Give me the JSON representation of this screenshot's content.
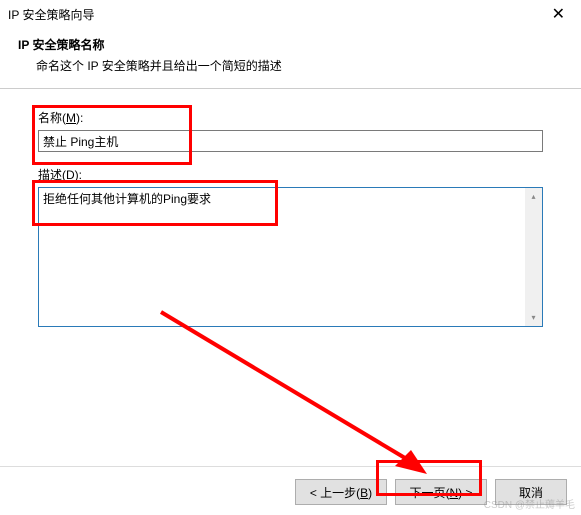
{
  "window": {
    "title": "IP 安全策略向导",
    "close_glyph": "✕"
  },
  "header": {
    "title": "IP 安全策略名称",
    "subtitle": "命名这个 IP 安全策略并且给出一个简短的描述"
  },
  "fields": {
    "name": {
      "label_prefix": "名称(",
      "label_hotkey": "M",
      "label_suffix": "):",
      "value": "禁止 Ping主机"
    },
    "description": {
      "label_prefix": "描述(",
      "label_hotkey": "D",
      "label_suffix": "):",
      "value": "拒绝任何其他计算机的Ping要求"
    }
  },
  "buttons": {
    "back_prefix": "< 上一步(",
    "back_hotkey": "B",
    "back_suffix": ")",
    "next_prefix": "下一页(",
    "next_hotkey": "N",
    "next_suffix": ") >",
    "cancel": "取消"
  },
  "scroll": {
    "up": "▴",
    "down": "▾"
  },
  "watermark": "CSDN @禁止薅羊毛"
}
